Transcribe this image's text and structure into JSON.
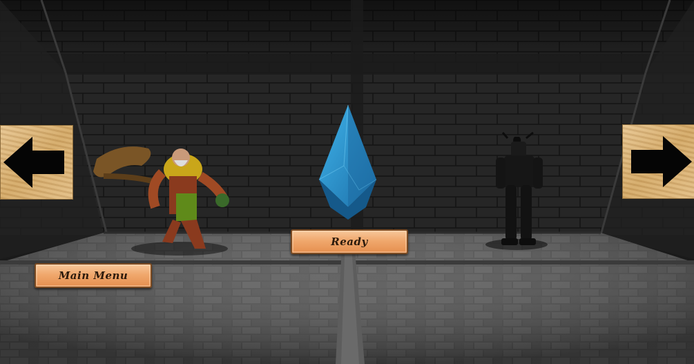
{
  "buttons": {
    "ready_label": "Ready",
    "main_menu_label": "Main Menu"
  },
  "icons": {
    "prev": "arrow-left-icon",
    "next": "arrow-right-icon",
    "crystal": "crystal-icon"
  },
  "colors": {
    "crystal": "#2a8fcf",
    "button_wood": "#f0a86d"
  }
}
